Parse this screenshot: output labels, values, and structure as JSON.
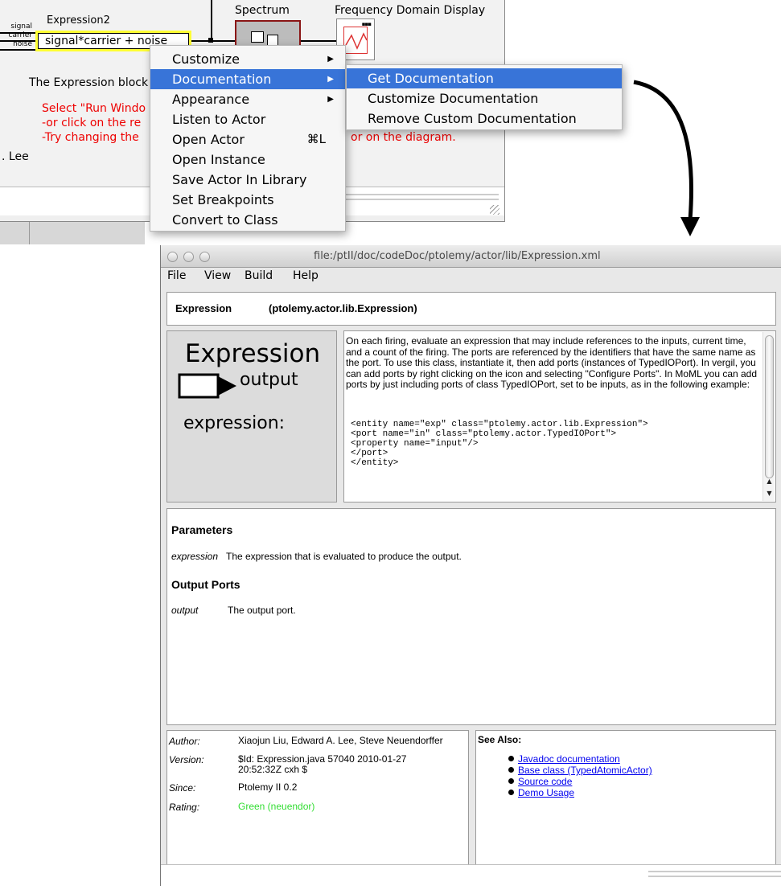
{
  "canvas": {
    "expression_actor": {
      "title": "Expression2",
      "value": "signal*carrier + noise",
      "ports": [
        "signal",
        "carrier",
        "noise"
      ]
    },
    "spectrum_label": "Spectrum",
    "fdd_label": "Frequency Domain Display",
    "doc_line": "The Expression block",
    "red_lines": [
      "Select \"Run Windo",
      "-or click on the re",
      "-Try changing the"
    ],
    "red_tail": "or on the diagram.",
    "author_fragment": ". Lee",
    "colors": {
      "highlight": "#ffff33",
      "annotation": "#ee0000"
    }
  },
  "context_menu": {
    "items": [
      {
        "label": "Customize",
        "submenu": true
      },
      {
        "label": "Documentation",
        "submenu": true,
        "highlighted": true
      },
      {
        "label": "Appearance",
        "submenu": true
      },
      {
        "label": "Listen to Actor"
      },
      {
        "label": "Open Actor",
        "shortcut": "⌘L"
      },
      {
        "label": "Open Instance"
      },
      {
        "label": "Save Actor In Library"
      },
      {
        "label": "Set Breakpoints"
      },
      {
        "label": "Convert to Class"
      }
    ],
    "highlight_color": "#3874d8"
  },
  "submenu": {
    "items": [
      {
        "label": "Get Documentation",
        "highlighted": true
      },
      {
        "label": "Customize Documentation"
      },
      {
        "label": "Remove Custom Documentation"
      }
    ]
  },
  "doc_window": {
    "title": "file:/ptII/doc/codeDoc/ptolemy/actor/lib/Expression.xml",
    "menus": [
      "File",
      "View",
      "Build",
      "Help"
    ],
    "actor_name": "Expression",
    "actor_class": "(ptolemy.actor.lib.Expression)",
    "icon": {
      "title": "Expression",
      "port_label": "output",
      "param_label": "expression:"
    },
    "description": "On each firing, evaluate an expression that may include references to the inputs, current time, and a count of the firing. The ports are referenced by the identifiers that have the same name as the port. To use this class, instantiate it, then add ports (instances of TypedIOPort). In vergil, you can add ports by right clicking on the icon and selecting \"Configure Ports\". In MoML you can add ports by just including ports of class TypedIOPort, set to be inputs, as in the following example:",
    "code": "<entity name=\"exp\" class=\"ptolemy.actor.lib.Expression\">\n<port name=\"in\" class=\"ptolemy.actor.TypedIOPort\">\n<property name=\"input\"/>\n</port>\n</entity>",
    "parameters_heading": "Parameters",
    "parameters": [
      {
        "name": "expression",
        "desc": "The expression that is evaluated to produce the output."
      }
    ],
    "output_ports_heading": "Output Ports",
    "output_ports": [
      {
        "name": "output",
        "desc": "The output port."
      }
    ],
    "meta": {
      "author_label": "Author:",
      "author": "Xiaojun Liu, Edward A. Lee, Steve Neuendorffer",
      "version_label": "Version:",
      "version": "$Id: Expression.java 57040 2010-01-27 20:52:32Z cxh $",
      "since_label": "Since:",
      "since": "Ptolemy II 0.2",
      "rating_label": "Rating:",
      "rating": "Green (neuendor)",
      "rating_color": "#33dd33"
    },
    "see_also": {
      "heading": "See Also:",
      "links": [
        "Javadoc documentation",
        "Base class (TypedAtomicActor)",
        "Source code",
        "Demo Usage"
      ],
      "link_color": "#0000ee"
    }
  }
}
